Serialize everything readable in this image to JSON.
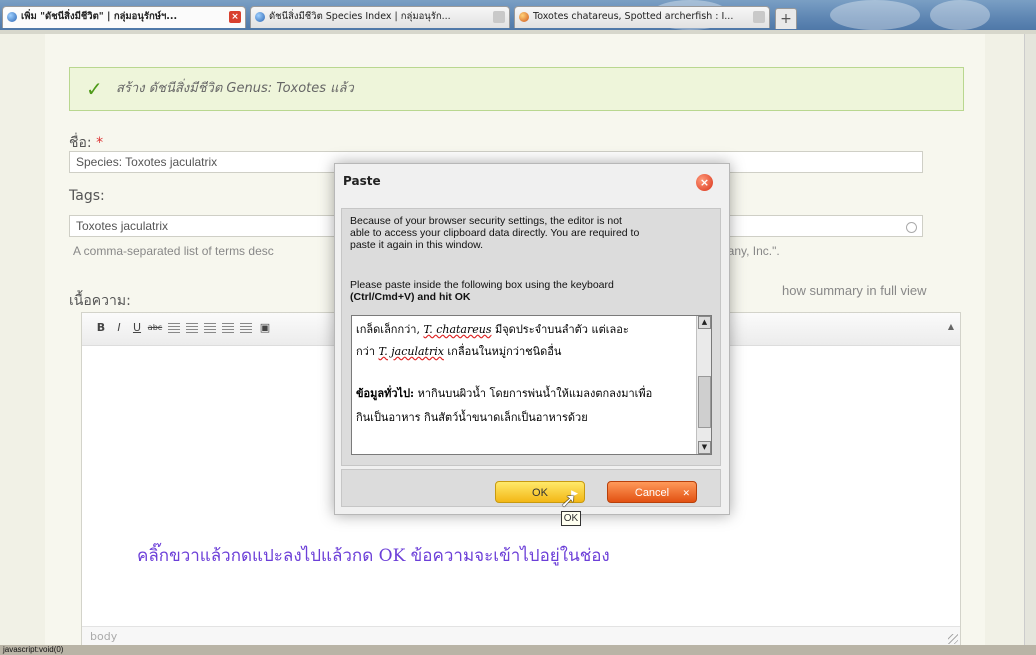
{
  "browser": {
    "tabs": [
      {
        "label": "เพิ่ม \"ดัชนีสิ่งมีชีวิต\" | กลุ่มอนุรักษ์ฯ...",
        "active": true,
        "close": "×"
      },
      {
        "label": "ดัชนีสิ่งมีชีวิต Species Index | กลุ่มอนุรัก...",
        "active": false
      },
      {
        "label": "Toxotes chatareus, Spotted archerfish : I...",
        "active": false
      }
    ],
    "new_tab": "+",
    "status": "javascript:void(0)"
  },
  "page": {
    "message": "สร้าง ดัชนีสิ่งมีชีวิต Genus: Toxotes แล้ว",
    "name_label": "ชื่อ:",
    "required_mark": "*",
    "name_value": "Species: Toxotes jaculatrix",
    "tags_label": "Tags:",
    "tags_value": "Toxotes jaculatrix",
    "tags_desc": "A comma-separated list of terms desc",
    "tags_desc_tail": "pany, Inc.\".",
    "summary_link": "how summary in full view",
    "body_label": "เนื้อความ:",
    "editor_status": "body",
    "instruction": "คลิ๊กขวาแล้วกดแปะลงไปแล้วกด OK ข้อความจะเข้าไปอยู่ในช่อง"
  },
  "toolbar": {
    "bold": "B",
    "italic": "I",
    "underline": "U",
    "strike": "abc"
  },
  "dialog": {
    "title": "Paste",
    "close": "×",
    "notice": [
      "Because of your browser security settings, the editor is not",
      "able to access your clipboard data directly. You are required to",
      "paste it again in this window."
    ],
    "instruction": [
      "Please paste inside the following box using the keyboard",
      "(Ctrl/Cmd+V) and hit OK"
    ],
    "pasted": {
      "line1_prefix": "เกล็ดเล็กกว่า,",
      "line1_sci": "T. chatareus",
      "line1_suffix": "มีจุดประจำบนลำตัว แต่เลอะ",
      "line2_prefix": "กว่า",
      "line2_sci": "T. jaculatrix",
      "line2_suffix": "เกลื่อนในหมู่กว่าชนิดอื่น",
      "line3_bold": "ข้อมูลทั่วไป:",
      "line3_rest": "หากินบนผิวน้ำ โดยการพ่นน้ำให้แมลงตกลงมาเพื่อ",
      "line4": "กินเป็นอาหาร กินสัตว์น้ำขนาดเล็กเป็นอาหารด้วย"
    },
    "ok_label": "OK",
    "cancel_label": "Cancel",
    "tooltip": "OK"
  },
  "colors": {
    "accent_ok": "#f3b716",
    "accent_cancel": "#e25112",
    "instruction_text": "#6c3fd8"
  }
}
